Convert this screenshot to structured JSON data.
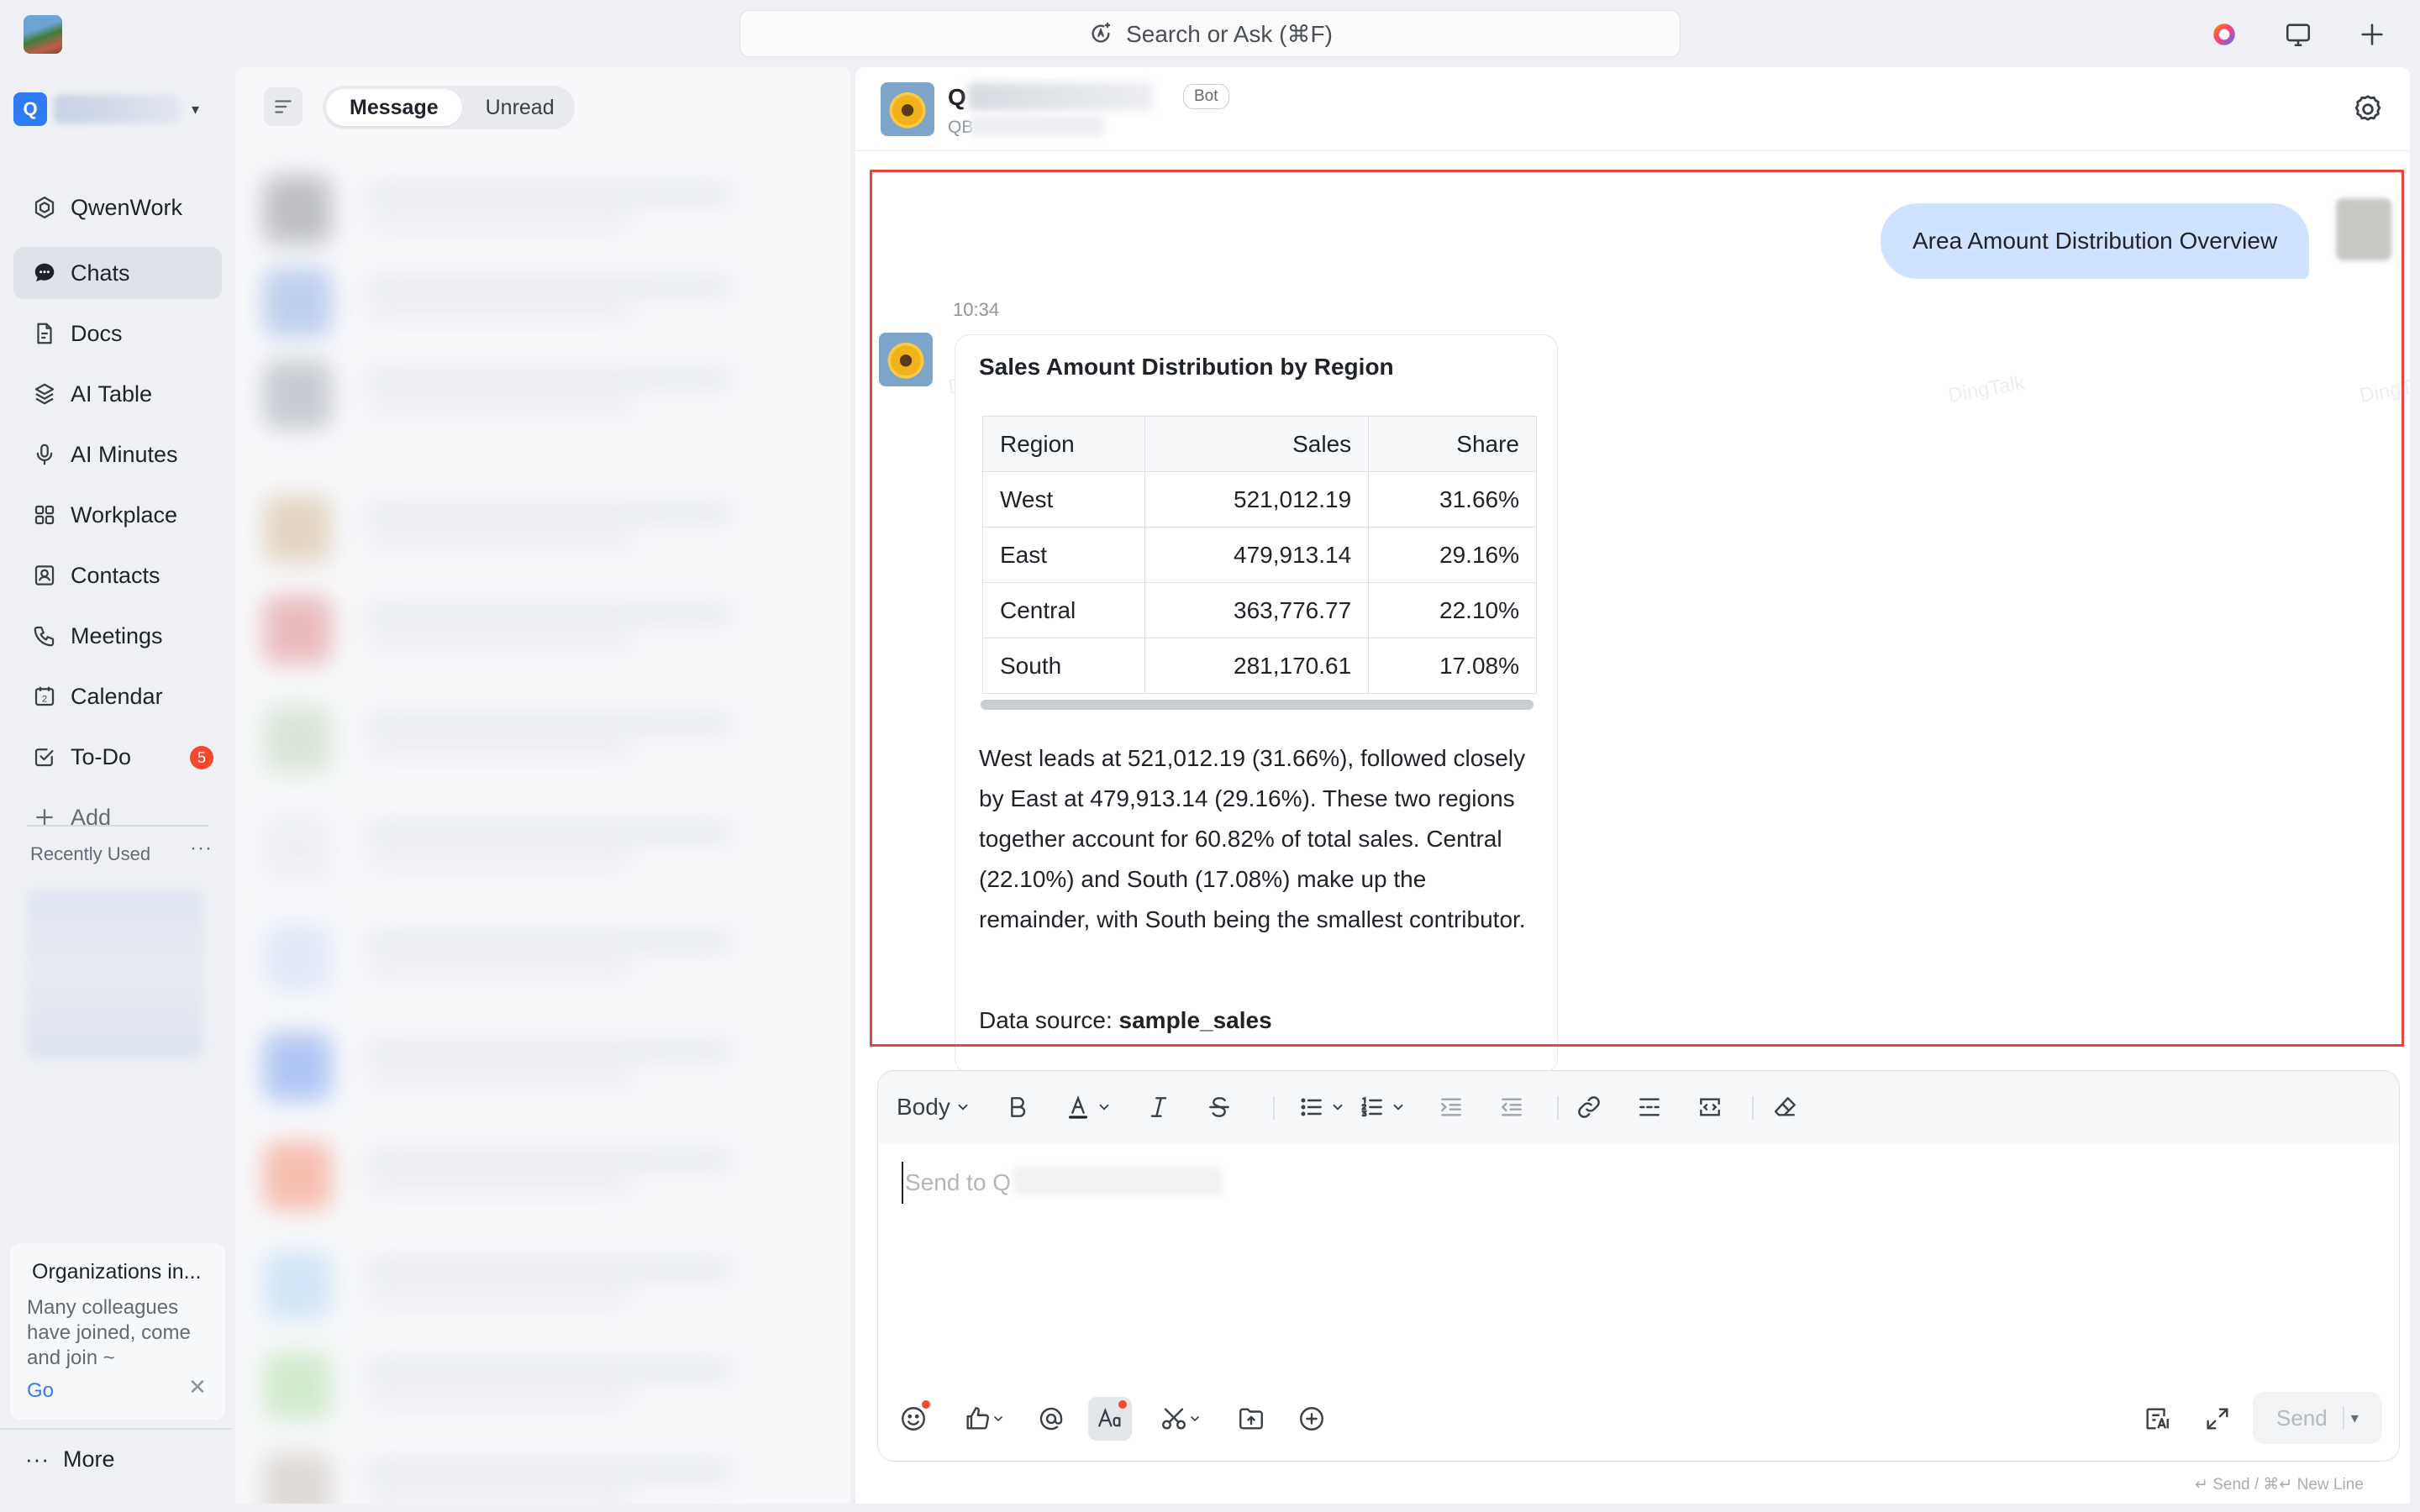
{
  "topbar": {
    "search_label": "Search or Ask (⌘F)"
  },
  "nav": {
    "org_initial": "Q",
    "items": [
      {
        "label": "QwenWork",
        "icon": "qwen-logo-icon"
      },
      {
        "label": "Chats",
        "icon": "chat-bubble-icon",
        "active": true
      },
      {
        "label": "Docs",
        "icon": "docs-icon"
      },
      {
        "label": "AI Table",
        "icon": "ai-table-icon"
      },
      {
        "label": "AI Minutes",
        "icon": "microphone-icon"
      },
      {
        "label": "Workplace",
        "icon": "grid-icon"
      },
      {
        "label": "Contacts",
        "icon": "contacts-icon"
      },
      {
        "label": "Meetings",
        "icon": "phone-icon"
      },
      {
        "label": "Calendar",
        "icon": "calendar-icon",
        "calendar_day": "2"
      },
      {
        "label": "To-Do",
        "icon": "todo-icon",
        "badge": "5"
      },
      {
        "label": "Add",
        "icon": "plus-icon"
      }
    ],
    "recently_used_label": "Recently Used",
    "recently_used_more": "···",
    "more_label": "More",
    "more_dots": "···"
  },
  "org_card": {
    "title": "Organizations in...",
    "description": "Many colleagues have joined, come and join ~",
    "go_label": "Go",
    "close_label": "✕"
  },
  "list_panel": {
    "tabs": [
      {
        "label": "Message",
        "active": true
      },
      {
        "label": "Unread",
        "active": false
      }
    ]
  },
  "chat": {
    "title_initial": "Q",
    "bot_tag": "Bot",
    "subtitle_prefix": "QB",
    "watermark_text": "DingTalk",
    "user_message": "Area Amount Distribution Overview",
    "message_time": "10:34",
    "card": {
      "title": "Sales Amount Distribution by Region",
      "table": {
        "headers": [
          "Region",
          "Sales",
          "Share"
        ],
        "rows": [
          [
            "West",
            "521,012.19",
            "31.66%"
          ],
          [
            "East",
            "479,913.14",
            "29.16%"
          ],
          [
            "Central",
            "363,776.77",
            "22.10%"
          ],
          [
            "South",
            "281,170.61",
            "17.08%"
          ]
        ]
      },
      "summary": "West leads at 521,012.19 (31.66%), followed closely by East at 479,913.14 (29.16%). These two regions together account for 60.82% of total sales. Central (22.10%) and South (17.08%) make up the remainder, with South being the smallest contributor.",
      "source_label": "Data source:",
      "source_value": "sample_sales"
    }
  },
  "composer": {
    "style_label": "Body",
    "placeholder": "Send to Q",
    "send_label": "Send",
    "hint": "↵ Send / ⌘↵ New Line"
  },
  "colors": {
    "accent": "#2f7cf6",
    "user_bubble": "#cfe2ff",
    "highlight": "#e5483e",
    "badge": "#f5492f"
  }
}
